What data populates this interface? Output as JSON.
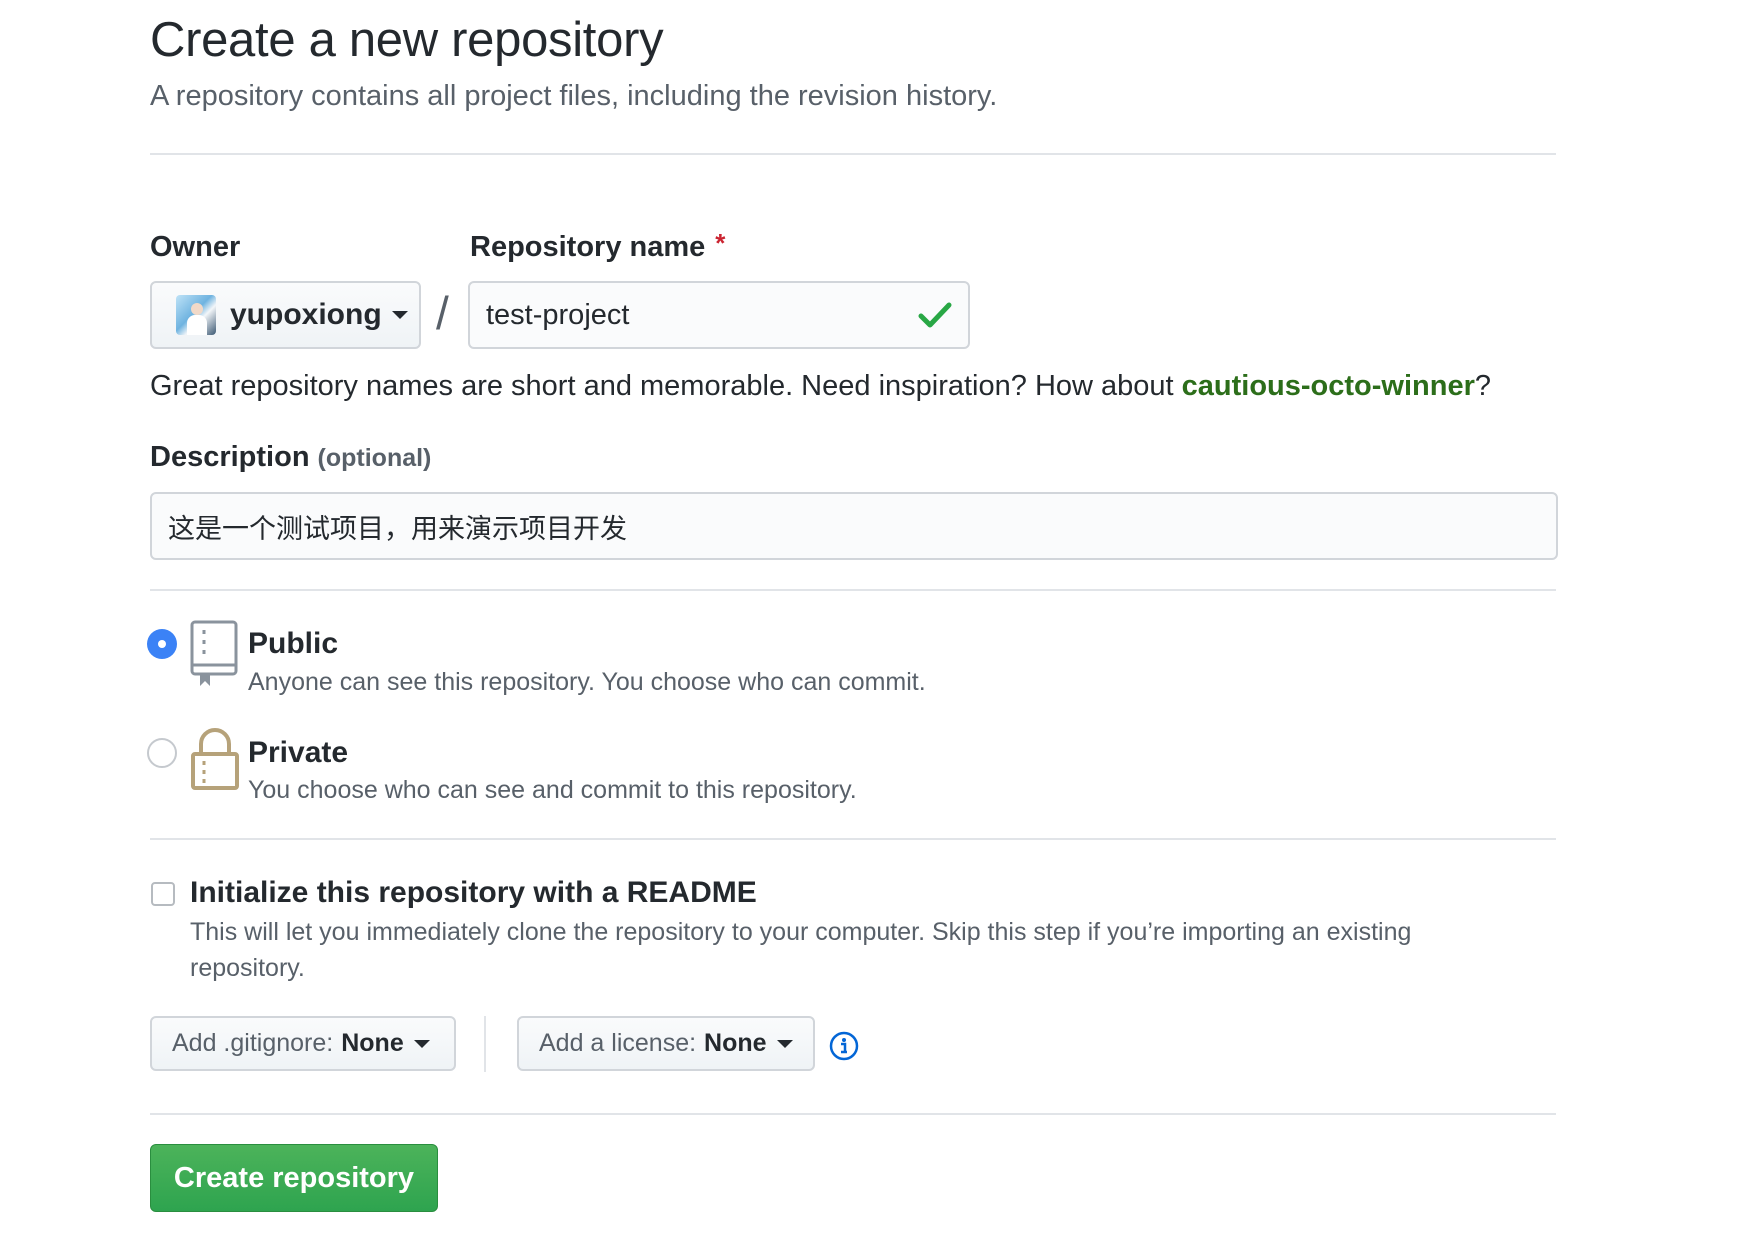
{
  "header": {
    "title": "Create a new repository",
    "subtitle": "A repository contains all project files, including the revision history."
  },
  "owner": {
    "label": "Owner",
    "name": "yupoxiong"
  },
  "repo": {
    "label": "Repository name",
    "required_mark": "*",
    "separator": "/",
    "value": "test-project"
  },
  "hint": {
    "text": "Great repository names are short and memorable. Need inspiration? How about ",
    "suggestion": "cautious-octo-winner",
    "suffix": "?"
  },
  "description": {
    "label": "Description",
    "optional": "(optional)",
    "value": "这是一个测试项目，用来演示项目开发"
  },
  "visibility": {
    "selected": "public",
    "public": {
      "title": "Public",
      "desc": "Anyone can see this repository. You choose who can commit."
    },
    "private": {
      "title": "Private",
      "desc": "You choose who can see and commit to this repository."
    }
  },
  "init": {
    "title": "Initialize this repository with a README",
    "desc": "This will let you immediately clone the repository to your computer. Skip this step if you’re importing an existing repository.",
    "checked": false
  },
  "gitignore": {
    "label": "Add .gitignore:",
    "value": "None"
  },
  "license": {
    "label": "Add a license:",
    "value": "None"
  },
  "submit": {
    "label": "Create repository"
  },
  "colors": {
    "accent_blue": "#3b82f6",
    "suggestion_green": "#2c6e1a",
    "button_green": "#2ea44f",
    "required_red": "#cb2431",
    "lock_tan": "#b6a27a"
  }
}
